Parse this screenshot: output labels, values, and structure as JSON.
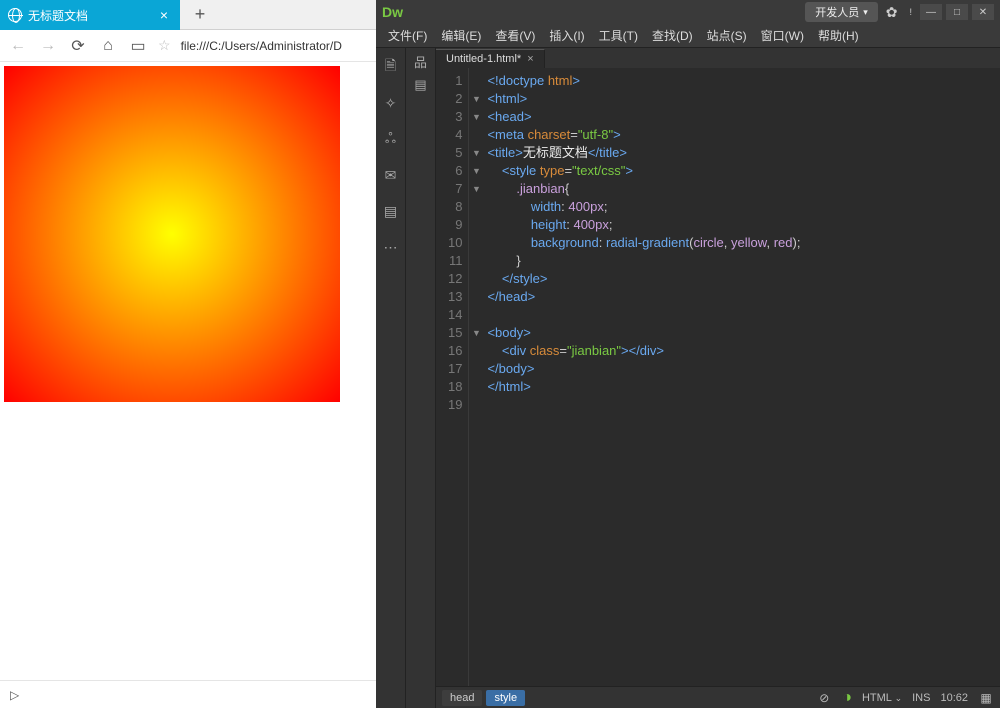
{
  "browser": {
    "tab_title": "无标题文档",
    "url": "file:///C:/Users/Administrator/D"
  },
  "dw": {
    "logo": "Dw",
    "workspace": "开发人员",
    "menus": [
      "文件(F)",
      "编辑(E)",
      "查看(V)",
      "插入(I)",
      "工具(T)",
      "查找(D)",
      "站点(S)",
      "窗口(W)",
      "帮助(H)"
    ],
    "file_tab": "Untitled-1.html*",
    "line_count": 19,
    "fold_lines": [
      2,
      3,
      5,
      6,
      7,
      15
    ],
    "code_lines": [
      [
        [
          "t-tag",
          "<!doctype "
        ],
        [
          "t-attr",
          "html"
        ],
        [
          "t-tag",
          ">"
        ]
      ],
      [
        [
          "t-tag",
          "<html>"
        ]
      ],
      [
        [
          "t-tag",
          "<head>"
        ]
      ],
      [
        [
          "t-tag",
          "<meta "
        ],
        [
          "t-attr",
          "charset"
        ],
        [
          "t-punc",
          "="
        ],
        [
          "t-str",
          "\"utf-8\""
        ],
        [
          "t-tag",
          ">"
        ]
      ],
      [
        [
          "t-tag",
          "<title>"
        ],
        [
          "t-text",
          "无标题文档"
        ],
        [
          "t-tag",
          "</title>"
        ]
      ],
      [
        [
          "t-punc",
          "    "
        ],
        [
          "t-tag",
          "<style "
        ],
        [
          "t-attr",
          "type"
        ],
        [
          "t-punc",
          "="
        ],
        [
          "t-str",
          "\"text/css\""
        ],
        [
          "t-tag",
          ">"
        ]
      ],
      [
        [
          "t-punc",
          "        "
        ],
        [
          "t-css",
          ".jianbian"
        ],
        [
          "t-punc",
          "{"
        ]
      ],
      [
        [
          "t-punc",
          "            "
        ],
        [
          "t-key",
          "width"
        ],
        [
          "t-punc",
          ": "
        ],
        [
          "t-val",
          "400px"
        ],
        [
          "t-punc",
          ";"
        ]
      ],
      [
        [
          "t-punc",
          "            "
        ],
        [
          "t-key",
          "height"
        ],
        [
          "t-punc",
          ": "
        ],
        [
          "t-val",
          "400px"
        ],
        [
          "t-punc",
          ";"
        ]
      ],
      [
        [
          "t-punc",
          "            "
        ],
        [
          "t-key",
          "background"
        ],
        [
          "t-punc",
          ": "
        ],
        [
          "t-fn",
          "radial-gradient"
        ],
        [
          "t-punc",
          "("
        ],
        [
          "t-val",
          "circle"
        ],
        [
          "t-punc",
          ", "
        ],
        [
          "t-val",
          "yellow"
        ],
        [
          "t-punc",
          ", "
        ],
        [
          "t-val",
          "red"
        ],
        [
          "t-punc",
          ");"
        ]
      ],
      [
        [
          "t-punc",
          "        }"
        ]
      ],
      [
        [
          "t-punc",
          "    "
        ],
        [
          "t-tag",
          "</style>"
        ]
      ],
      [
        [
          "t-tag",
          "</head>"
        ]
      ],
      [
        [
          "t-punc",
          ""
        ]
      ],
      [
        [
          "t-tag",
          "<body>"
        ]
      ],
      [
        [
          "t-punc",
          "    "
        ],
        [
          "t-tag",
          "<div "
        ],
        [
          "t-attr",
          "class"
        ],
        [
          "t-punc",
          "="
        ],
        [
          "t-str",
          "\"jianbian\""
        ],
        [
          "t-tag",
          "></div>"
        ]
      ],
      [
        [
          "t-tag",
          "</body>"
        ]
      ],
      [
        [
          "t-tag",
          "</html>"
        ]
      ],
      [
        [
          "t-punc",
          ""
        ]
      ]
    ],
    "breadcrumbs": [
      "head",
      "style"
    ],
    "status": {
      "lang": "HTML",
      "mode": "INS",
      "pos": "10:62"
    }
  }
}
